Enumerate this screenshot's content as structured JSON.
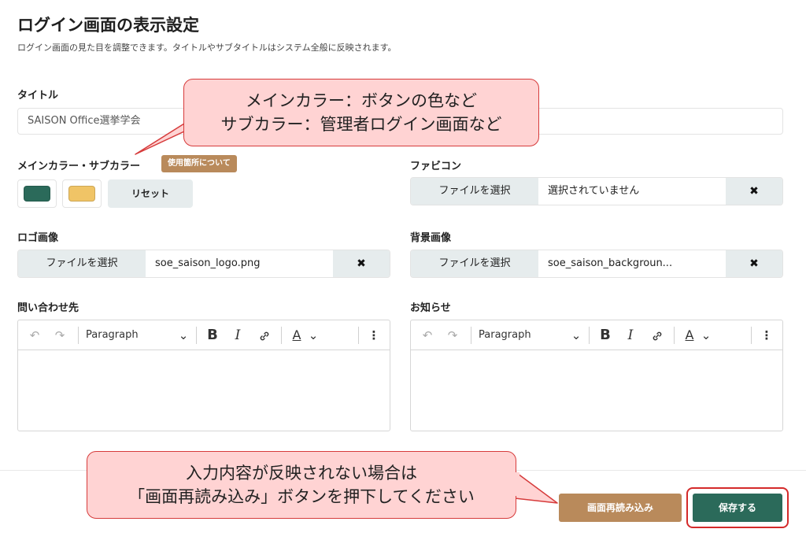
{
  "header": {
    "title": "ログイン画面の表示設定",
    "description": "ログイン画面の見た目を調整できます。タイトルやサブタイトルはシステム全般に反映されます。"
  },
  "title_field": {
    "label": "タイトル",
    "value": "SAISON Office選挙学会"
  },
  "colors": {
    "label": "メインカラー・サブカラー",
    "badge": "使用箇所について",
    "main_color": "#2b6a5a",
    "sub_color": "#f0c466",
    "reset_label": "リセット"
  },
  "favicon": {
    "label": "ファビコン",
    "choose_label": "ファイルを選択",
    "file_name": "選択されていません",
    "clear_icon": "✖"
  },
  "logo": {
    "label": "ロゴ画像",
    "choose_label": "ファイルを選択",
    "file_name": "soe_saison_logo.png",
    "clear_icon": "✖"
  },
  "background": {
    "label": "背景画像",
    "choose_label": "ファイルを選択",
    "file_name": "soe_saison_backgroun...",
    "clear_icon": "✖"
  },
  "contact": {
    "label": "問い合わせ先"
  },
  "notice": {
    "label": "お知らせ"
  },
  "editor_toolbar": {
    "undo": "↶",
    "redo": "↷",
    "paragraph": "Paragraph",
    "dropdown": "⌄",
    "bold": "B",
    "italic": "I",
    "link": "🔗",
    "font_color": "A",
    "more": "⋮"
  },
  "footer": {
    "reload_label": "画面再読み込み",
    "save_label": "保存する"
  },
  "callouts": {
    "colors_note": [
      "メインカラー：ボタンの色など",
      "サブカラー：管理者ログイン画面など"
    ],
    "reload_note": [
      "入力内容が反映されない場合は",
      "「画面再読み込み」ボタンを押下してください"
    ]
  }
}
